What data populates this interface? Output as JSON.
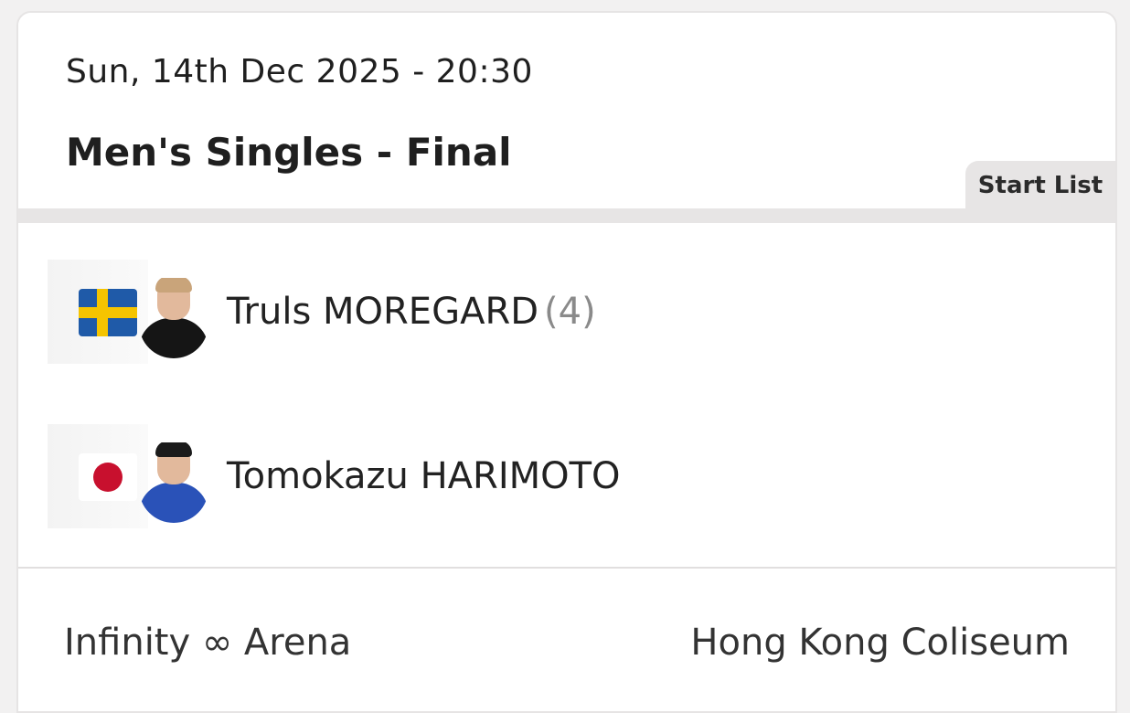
{
  "match": {
    "datetime": "Sun, 14th Dec 2025 - 20:30",
    "title": "Men's Singles - Final",
    "start_list_label": "Start List"
  },
  "players": [
    {
      "name": "Truls MOREGARD",
      "seed": "(4)",
      "flag_icon": "sweden-flag-icon",
      "colors": {
        "flag_blue": "#1f5aa8",
        "flag_yellow": "#f5c400"
      }
    },
    {
      "name": "Tomokazu HARIMOTO",
      "seed": "",
      "flag_icon": "japan-flag-icon",
      "colors": {
        "flag_red": "#c8102e",
        "flag_white": "#ffffff"
      }
    }
  ],
  "venue": {
    "arena": "Infinity ∞ Arena",
    "location": "Hong Kong Coliseum"
  }
}
